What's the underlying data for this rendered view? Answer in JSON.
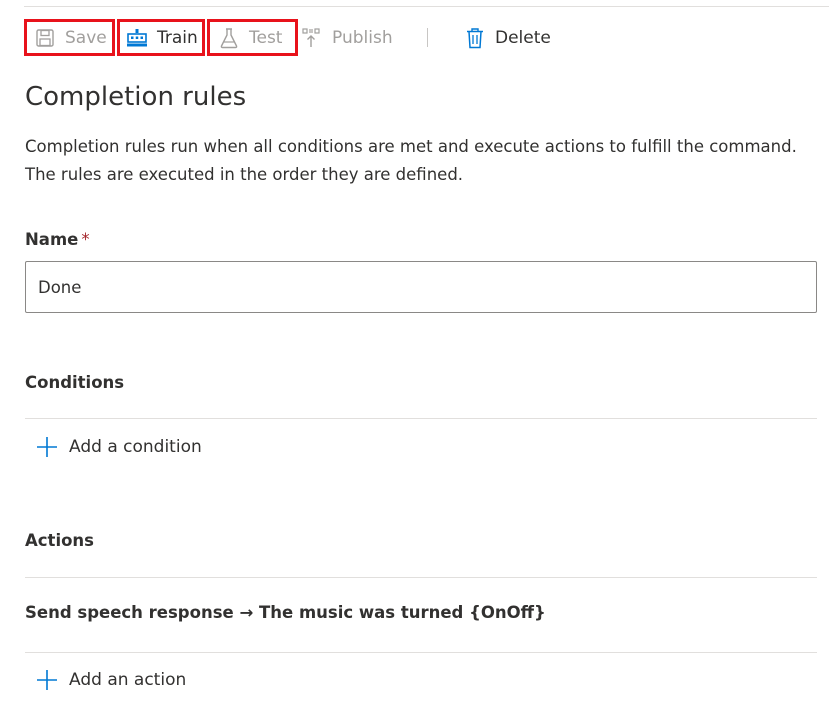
{
  "toolbar": {
    "save_label": "Save",
    "train_label": "Train",
    "test_label": "Test",
    "publish_label": "Publish",
    "delete_label": "Delete"
  },
  "colors": {
    "accent": "#0078d4",
    "highlight": "#e8121b",
    "disabled": "#a19f9d",
    "text": "#323130"
  },
  "icons": {
    "save": "save-icon",
    "train": "train-icon",
    "test": "flask-icon",
    "publish": "publish-icon",
    "delete": "trash-icon",
    "add": "plus-icon"
  },
  "page": {
    "title": "Completion rules",
    "description_line1": "Completion rules run when all conditions are met and execute actions to fulfill the command.",
    "description_line2": "The rules are executed in the order they are defined."
  },
  "name_field": {
    "label": "Name",
    "required_mark": "*",
    "value": "Done"
  },
  "conditions": {
    "title": "Conditions",
    "add_label": "Add a condition"
  },
  "actions": {
    "title": "Actions",
    "items": [
      {
        "label": "Send speech response → The music was turned {OnOff}"
      }
    ],
    "add_label": "Add an action"
  }
}
